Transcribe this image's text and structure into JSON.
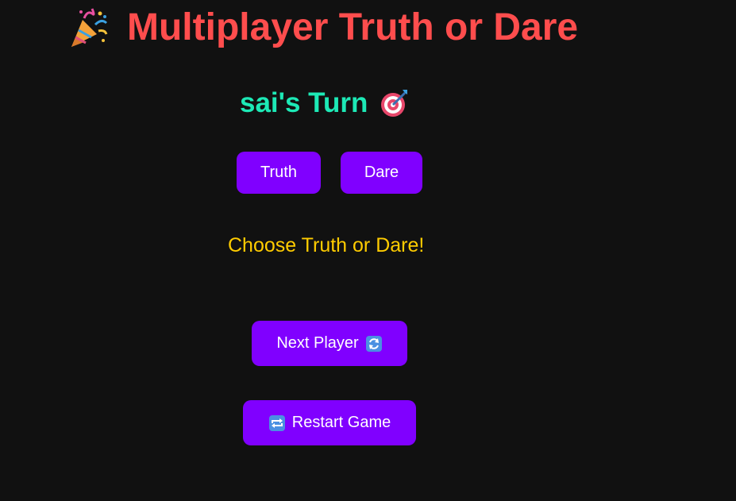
{
  "header": {
    "title": "Multiplayer Truth or Dare",
    "icon": "party-popper-icon"
  },
  "turn": {
    "text": "sai's Turn",
    "icon": "direct-hit-target-icon"
  },
  "choices": {
    "truth_label": "Truth",
    "dare_label": "Dare"
  },
  "prompt": {
    "text": "Choose Truth or Dare!"
  },
  "actions": {
    "next_player_label": "Next Player",
    "next_player_icon": "counterclockwise-arrows-icon",
    "restart_label": "Restart Game",
    "restart_icon": "repeat-icon"
  },
  "colors": {
    "background": "#111111",
    "title": "#ff4d4d",
    "turn": "#1de9b6",
    "prompt": "#ffcc00",
    "button": "#8000ff",
    "button_text": "#ffffff"
  }
}
